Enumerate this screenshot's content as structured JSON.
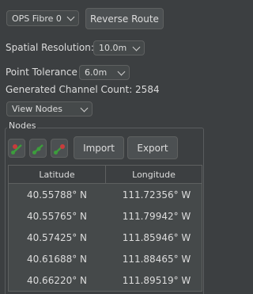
{
  "route_select": {
    "value": "OPS Fibre 0"
  },
  "reverse_route_label": "Reverse Route",
  "spatial_resolution": {
    "label": "Spatial Resolution:",
    "value": "10.0m"
  },
  "point_tolerance": {
    "label": "Point Tolerance",
    "value": "6.0m"
  },
  "generated_channel_count": "Generated Channel Count: 2584",
  "view_select": {
    "value": "View Nodes"
  },
  "nodes": {
    "title": "Nodes",
    "import_label": "Import",
    "export_label": "Export",
    "columns": [
      "Latitude",
      "Longitude"
    ],
    "rows": [
      {
        "lat": "40.55788° N",
        "lon": "111.72356° W"
      },
      {
        "lat": "40.55765° N",
        "lon": "111.79942° W"
      },
      {
        "lat": "40.57425° N",
        "lon": "111.85946° W"
      },
      {
        "lat": "40.61688° N",
        "lon": "111.88465° W"
      },
      {
        "lat": "40.66220° N",
        "lon": "111.89519° W"
      }
    ]
  },
  "icons": [
    "add-node-icon",
    "edit-node-icon",
    "remove-node-icon"
  ],
  "colors": {
    "background": "#3c3f41",
    "control": "#45494a",
    "text": "#dcdcdc",
    "accent_green": "#3c9d3c",
    "accent_red": "#c83c3c"
  }
}
